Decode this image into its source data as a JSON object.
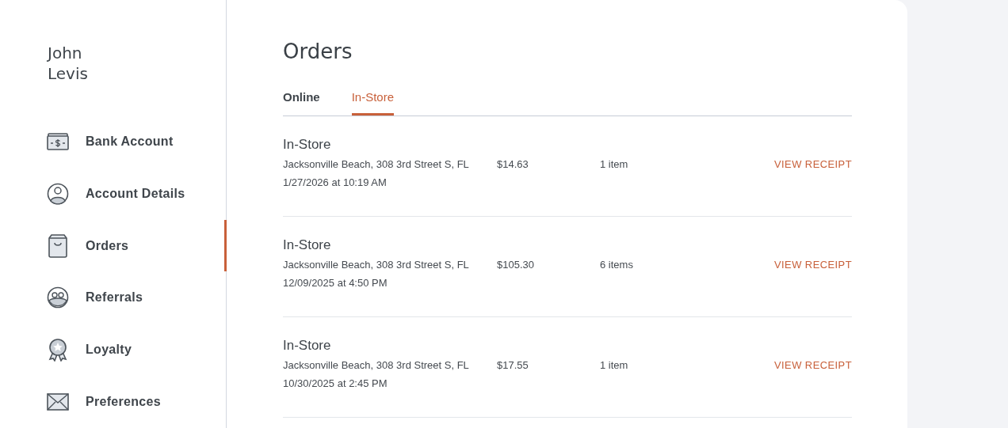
{
  "user": {
    "name_lines": [
      "John",
      "Levis"
    ]
  },
  "sidebar": {
    "items": [
      {
        "label": "Bank Account",
        "selected": false
      },
      {
        "label": "Account Details",
        "selected": false
      },
      {
        "label": "Orders",
        "selected": true
      },
      {
        "label": "Referrals",
        "selected": false
      },
      {
        "label": "Loyalty",
        "selected": false
      },
      {
        "label": "Preferences",
        "selected": false
      }
    ]
  },
  "page": {
    "title": "Orders"
  },
  "tabs": [
    {
      "label": "Online",
      "selected": false
    },
    {
      "label": "In-Store",
      "selected": true
    }
  ],
  "orders": [
    {
      "type": "In-Store",
      "address": "Jacksonville Beach, 308 3rd Street S, FL",
      "date": "1/27/2026 at 10:19 AM",
      "total": "$14.63",
      "items": "1 item",
      "action": "VIEW RECEIPT"
    },
    {
      "type": "In-Store",
      "address": "Jacksonville Beach, 308 3rd Street S, FL",
      "date": "12/09/2025 at 4:50 PM",
      "total": "$105.30",
      "items": "6 items",
      "action": "VIEW RECEIPT"
    },
    {
      "type": "In-Store",
      "address": "Jacksonville Beach, 308 3rd Street S, FL",
      "date": "10/30/2025 at 2:45 PM",
      "total": "$17.55",
      "items": "1 item",
      "action": "VIEW RECEIPT"
    }
  ]
}
